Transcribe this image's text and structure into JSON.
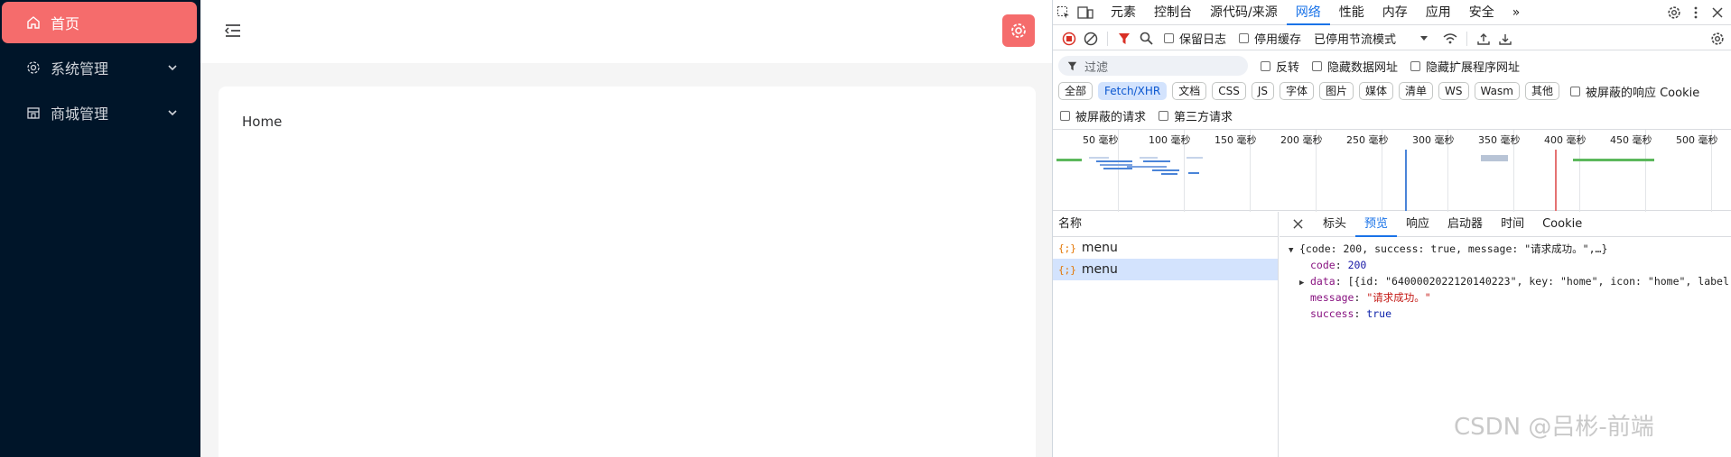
{
  "sidebar": {
    "items": [
      {
        "label": "首页",
        "icon": "home-icon",
        "active": true
      },
      {
        "label": "系统管理",
        "icon": "gear-icon",
        "expandable": true
      },
      {
        "label": "商城管理",
        "icon": "store-icon",
        "expandable": true
      }
    ]
  },
  "header": {
    "fold_icon": "menu-fold-icon",
    "settings_icon": "gear-icon"
  },
  "content": {
    "text": "Home"
  },
  "devtools": {
    "tabs": [
      "元素",
      "控制台",
      "源代码/来源",
      "网络",
      "性能",
      "内存",
      "应用",
      "安全",
      "»"
    ],
    "active_tab": "网络",
    "toolbar": {
      "preserve_log": "保留日志",
      "disable_cache": "停用缓存",
      "throttle": "已停用节流模式"
    },
    "filter": {
      "placeholder": "过滤",
      "invert": "反转",
      "hide_data_urls": "隐藏数据网址",
      "hide_extension_urls": "隐藏扩展程序网址"
    },
    "types": [
      "全部",
      "Fetch/XHR",
      "文档",
      "CSS",
      "JS",
      "字体",
      "图片",
      "媒体",
      "清单",
      "WS",
      "Wasm",
      "其他"
    ],
    "active_type": "Fetch/XHR",
    "blocked_cookies": "被屏蔽的响应 Cookie",
    "blocked_requests": "被屏蔽的请求",
    "third_party": "第三方请求",
    "timeline_ticks": [
      "50 毫秒",
      "100 毫秒",
      "150 毫秒",
      "200 毫秒",
      "250 毫秒",
      "300 毫秒",
      "350 毫秒",
      "400 毫秒",
      "450 毫秒",
      "500 毫秒"
    ],
    "requests": {
      "column": "名称",
      "rows": [
        "menu",
        "menu"
      ],
      "selected_index": 1
    },
    "detail_tabs": [
      "标头",
      "预览",
      "响应",
      "启动器",
      "时间",
      "Cookie"
    ],
    "active_detail_tab": "预览",
    "preview": {
      "summary": "{code: 200, success: true, message: \"请求成功。\",…}",
      "code_key": "code",
      "code_val": "200",
      "data_key": "data",
      "data_val": "[{id: \"6400002022120140223\", key: \"home\", icon: \"home\", label",
      "message_key": "message",
      "message_val": "\"请求成功。\"",
      "success_key": "success",
      "success_val": "true"
    }
  },
  "watermark": "CSDN @吕彬-前端"
}
